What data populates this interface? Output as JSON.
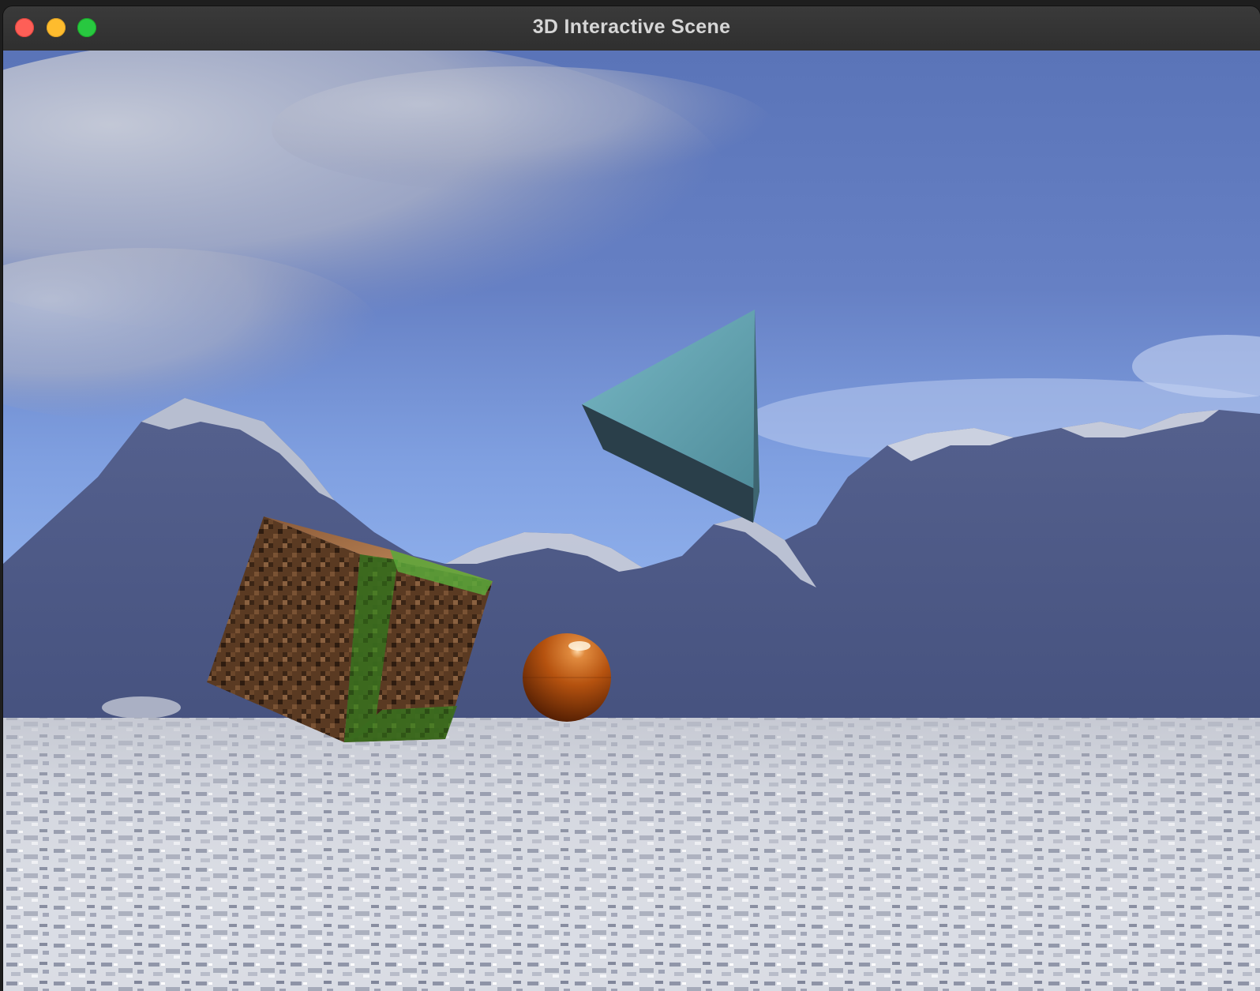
{
  "window": {
    "title": "3D Interactive Scene",
    "traffic_lights": {
      "close_color": "#fe5f57",
      "minimize_color": "#febc2e",
      "maximize_color": "#28c840"
    }
  },
  "scene": {
    "objects": [
      {
        "kind": "cube",
        "texture": "grass-dirt-block"
      },
      {
        "kind": "sphere",
        "material": "copper",
        "color": "#b5520f"
      },
      {
        "kind": "pyramid",
        "color": "#63a9b6"
      }
    ],
    "sky_color": "#6f8fd6",
    "ground": "snow-marble-plane",
    "background": "snowy-mountain-range"
  }
}
